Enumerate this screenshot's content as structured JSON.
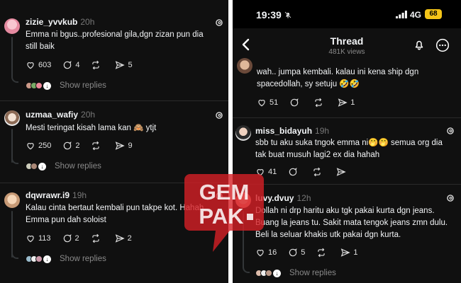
{
  "left": {
    "posts": [
      {
        "username": "zizie_yvvkub",
        "time": "20h",
        "text": "Emma ni bgus..profesional gila,dgn zizan pun dia still baik",
        "likes": "603",
        "comments": "4",
        "shares": "5",
        "show_replies": "Show replies"
      },
      {
        "username": "uzmaa_wafiy",
        "time": "20h",
        "text": "Mesti teringat kisah lama kan 🙈 ytjt",
        "likes": "250",
        "comments": "2",
        "shares": "9",
        "show_replies": "Show replies"
      },
      {
        "username": "dqwrawr.i9",
        "time": "19h",
        "text": "Kalau cinta bertaut kembali pun takpe kot. Hahah. Emma pun dah soloist",
        "likes": "113",
        "comments": "2",
        "shares": "2",
        "show_replies": "Show replies"
      }
    ]
  },
  "right": {
    "status": {
      "time": "19:39",
      "network": "4G",
      "battery": "68"
    },
    "header": {
      "title": "Thread",
      "views": "481K views"
    },
    "posts": [
      {
        "username": "",
        "time": "",
        "text": "wah.. jumpa kembali. kalau ini kena ship dgn spacedollah, sy setuju 🤣🤣",
        "likes": "51",
        "comments": "",
        "shares": "1"
      },
      {
        "username": "miss_bidayuh",
        "time": "19h",
        "text": "sbb tu aku suka tngok emma ni🤭🤭 semua org dia tak buat musuh lagi2 ex dia hahah",
        "likes": "41",
        "comments": "",
        "shares": ""
      },
      {
        "username": "luvy.dvuy",
        "time": "12h",
        "text": "Dollah ni drp haritu aku tgk pakai kurta dgn jeans. Buang la jeans tu. Sakit mata tengok jeans zmn dulu. Beli la seluar khakis utk pakai dgn kurta.",
        "likes": "16",
        "comments": "5",
        "shares": "1",
        "show_replies": "Show replies"
      }
    ]
  },
  "watermark": {
    "line1": "GEM",
    "line2": "PAK",
    "accent": "#d61f26"
  }
}
